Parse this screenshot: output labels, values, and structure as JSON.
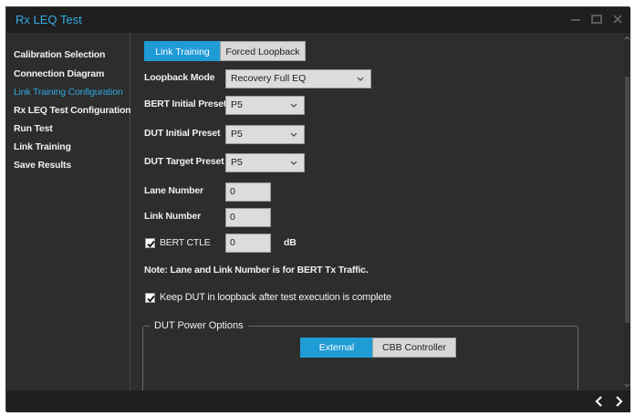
{
  "window": {
    "title": "Rx LEQ Test"
  },
  "sidebar": {
    "items": [
      {
        "label": "Calibration Selection"
      },
      {
        "label": "Connection Diagram"
      },
      {
        "label": "Link Training Configuration"
      },
      {
        "label": "Rx LEQ Test Configuration"
      },
      {
        "label": "Run Test"
      },
      {
        "label": "Link Training"
      },
      {
        "label": "Save Results"
      }
    ],
    "active_index": 2
  },
  "tabs": [
    {
      "label": "Link Training",
      "active": true
    },
    {
      "label": "Forced Loopback",
      "active": false
    }
  ],
  "form": {
    "loopback_mode": {
      "label": "Loopback Mode",
      "value": "Recovery Full EQ"
    },
    "bert_initial_preset": {
      "label": "BERT Initial Preset",
      "value": "P5"
    },
    "dut_initial_preset": {
      "label": "DUT Initial Preset",
      "value": "P5"
    },
    "dut_target_preset": {
      "label": "DUT Target Preset",
      "value": "P5"
    },
    "lane_number": {
      "label": "Lane Number",
      "value": "0"
    },
    "link_number": {
      "label": "Link Number",
      "value": "0"
    },
    "bert_ctle": {
      "label": "BERT CTLE",
      "checked": true,
      "value": "0",
      "unit": "dB"
    },
    "note": "Note: Lane and Link Number is for BERT Tx Traffic.",
    "keep_dut_loopback": {
      "label": "Keep DUT in loopback after test execution is complete",
      "checked": true
    }
  },
  "dut_power_options": {
    "title": "DUT Power Options",
    "buttons": [
      {
        "label": "External",
        "active": true
      },
      {
        "label": "CBB Controller",
        "active": false
      }
    ]
  },
  "colors": {
    "accent": "#1f9bd6",
    "sidebar_active": "#2fa6dd",
    "title": "#35a9e0",
    "window_bg": "#2d2d2d",
    "titlebar_bg": "#1f1f1f"
  },
  "icons": {
    "minimize": "minimize-icon",
    "maximize": "maximize-icon",
    "close": "close-icon",
    "back": "chevron-left-icon",
    "next": "chevron-right-icon",
    "dropdown": "chevron-down-icon",
    "checkbox": "checkmark-icon"
  }
}
